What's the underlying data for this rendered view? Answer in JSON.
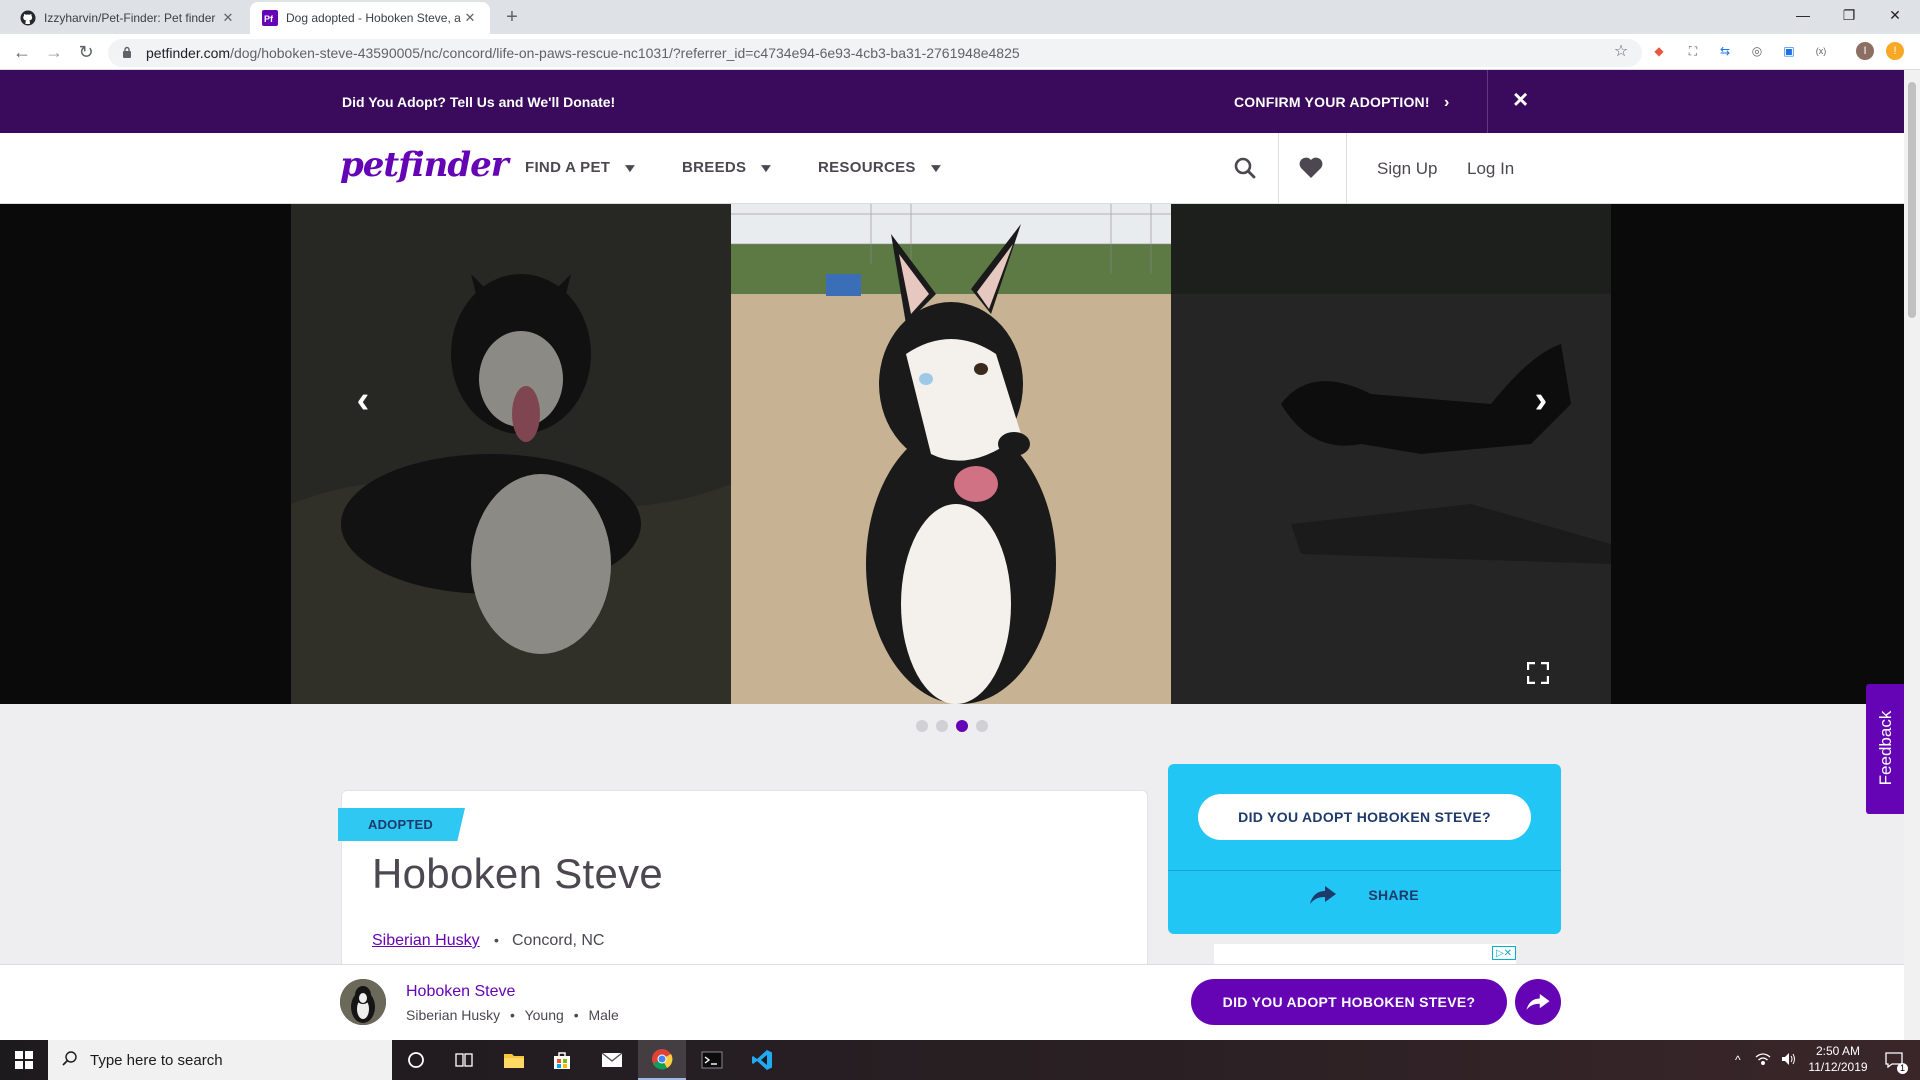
{
  "browser": {
    "tabs": [
      {
        "title": "Izzyharvin/Pet-Finder: Pet finder",
        "active": false,
        "icon": "github-icon"
      },
      {
        "title": "Dog adopted - Hoboken Steve, a",
        "active": true,
        "icon": "petfinder-icon"
      }
    ],
    "url_host": "petfinder.com",
    "url_path": "/dog/hoboken-steve-43590005/nc/concord/life-on-paws-rescue-nc1031/?referrer_id=c4734e94-6e93-4cb3-ba31-2761948e4825",
    "profile_initial": "I"
  },
  "banner": {
    "message": "Did You Adopt? Tell Us and We'll Donate!",
    "confirm_label": "CONFIRM YOUR ADOPTION!",
    "close_label": "×"
  },
  "header": {
    "logo_text": "petfinder",
    "nav": [
      "FIND A PET",
      "BREEDS",
      "RESOURCES"
    ],
    "signup_label": "Sign Up",
    "login_label": "Log In"
  },
  "carousel": {
    "slide_count": 4,
    "active_index": 2
  },
  "pet": {
    "status_tag": "ADOPTED",
    "name": "Hoboken Steve",
    "breed": "Siberian Husky",
    "separator": "•",
    "location": "Concord, NC",
    "age": "Young",
    "sex": "Male"
  },
  "sidebox": {
    "adopt_button": "DID YOU ADOPT HOBOKEN STEVE?",
    "share_label": "SHARE"
  },
  "feedback_label": "Feedback",
  "sticky_bar": {
    "name": "Hoboken Steve",
    "meta_breed": "Siberian Husky",
    "meta_age": "Young",
    "meta_sex": "Male",
    "sep": "•",
    "adopt_button": "DID YOU ADOPT HOBOKEN STEVE?"
  },
  "taskbar": {
    "search_placeholder": "Type here to search",
    "time": "2:50 AM",
    "date": "11/12/2019",
    "notification_count": "1"
  },
  "colors": {
    "brand_purple": "#6504b5",
    "banner_bg": "#3a0b5c",
    "accent_cyan": "#21c6f5"
  }
}
